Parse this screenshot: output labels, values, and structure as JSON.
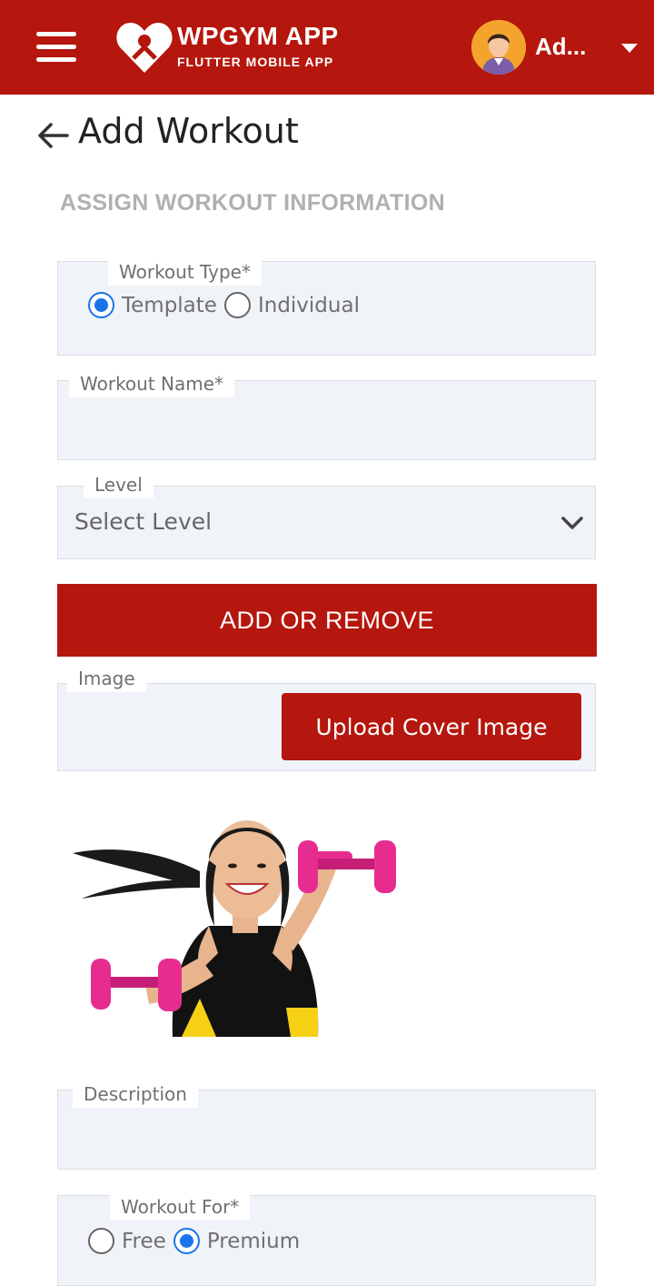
{
  "app_bar": {
    "brand_title": "WPGYM APP",
    "brand_subtitle": "FLUTTER MOBILE APP",
    "user_name": "Ad...",
    "icons": [
      "menu-icon",
      "brand-logo",
      "avatar",
      "caret-down-icon"
    ],
    "colors": {
      "primary": "#b5160d",
      "on_primary": "#ffffff"
    }
  },
  "page": {
    "title": "Add Workout",
    "section_title": "ASSIGN WORKOUT INFORMATION",
    "back_icon": "arrow-left-icon"
  },
  "form": {
    "workout_type": {
      "label": "Workout Type*",
      "options": [
        {
          "label": "Template",
          "selected": true
        },
        {
          "label": "Individual",
          "selected": false
        }
      ]
    },
    "workout_name": {
      "label": "Workout Name*",
      "value": ""
    },
    "level": {
      "label": "Level",
      "value": "Select Level"
    },
    "add_remove_button": "ADD OR REMOVE",
    "image": {
      "label": "Image",
      "upload_button": "Upload Cover Image"
    },
    "description": {
      "label": "Description",
      "value": ""
    },
    "workout_for": {
      "label": "Workout For*",
      "options": [
        {
          "label": "Free",
          "selected": false
        },
        {
          "label": "Premium",
          "selected": true
        }
      ]
    }
  },
  "colors": {
    "field_background": "#f0f3f8",
    "radio_selected": "#1a73e8",
    "section_title": "#b0b0b0"
  }
}
